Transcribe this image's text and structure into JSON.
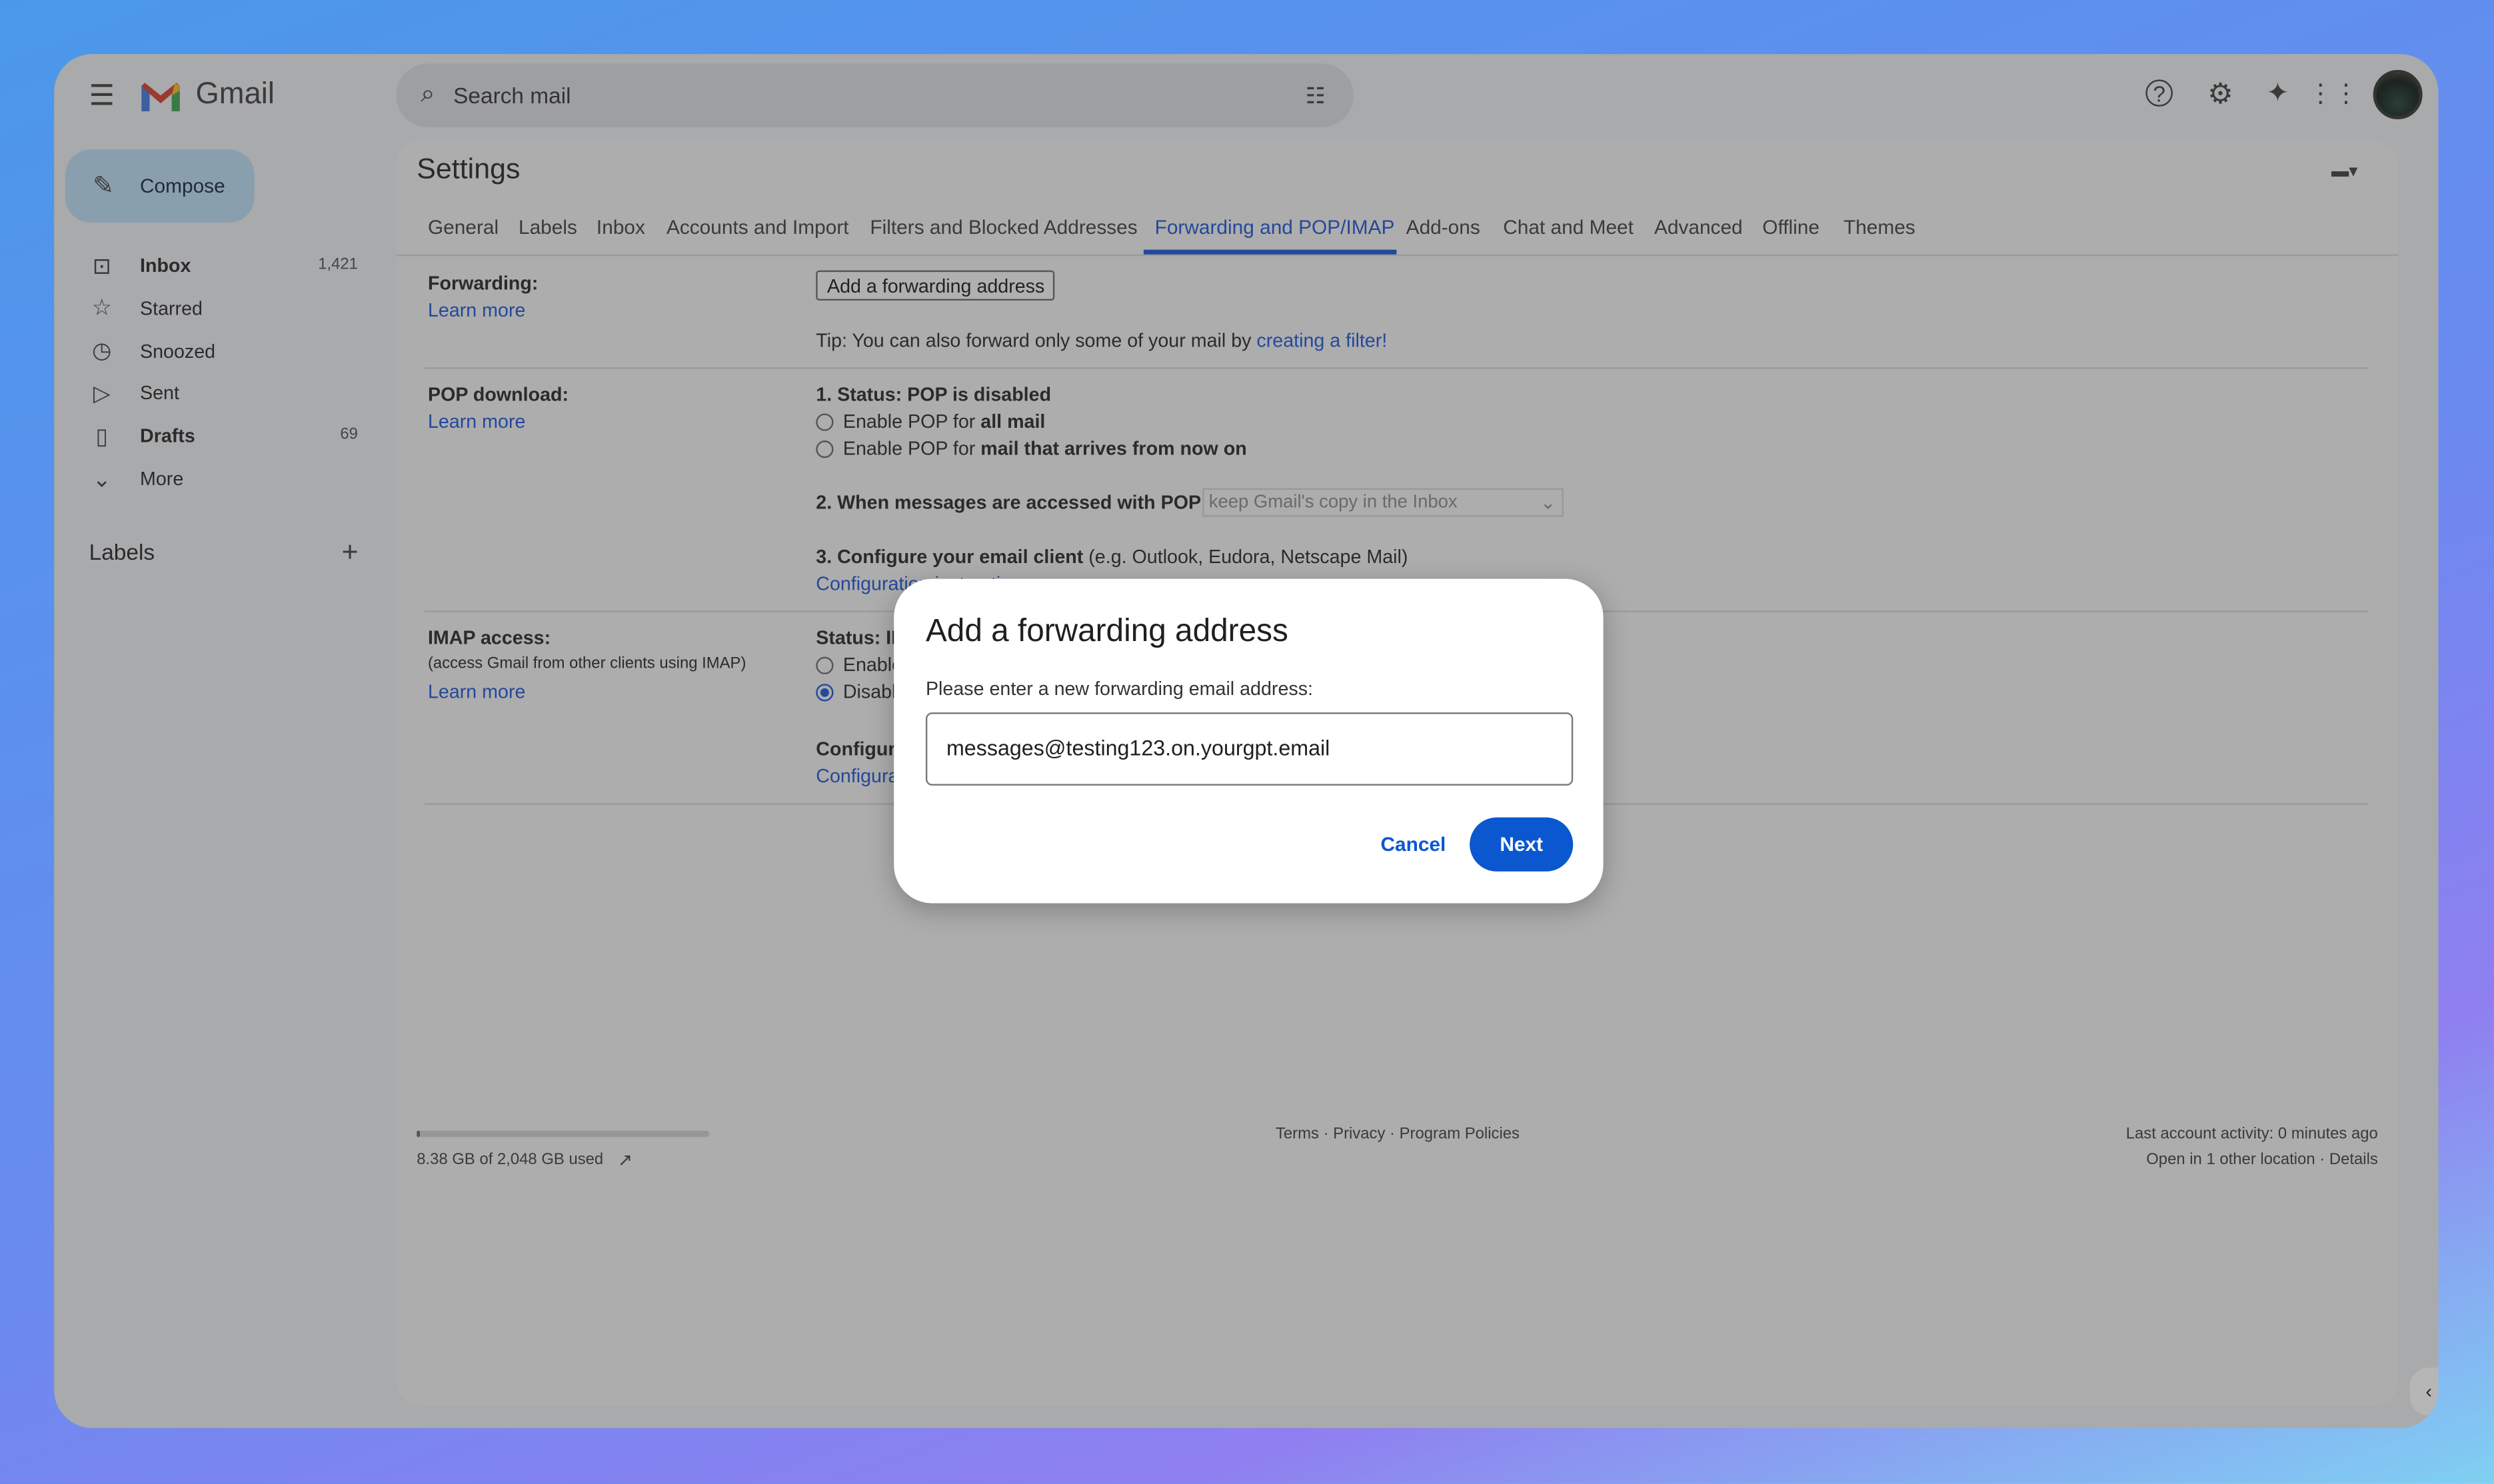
{
  "app": {
    "name": "Gmail"
  },
  "search": {
    "placeholder": "Search mail"
  },
  "compose": {
    "label": "Compose"
  },
  "nav": [
    {
      "label": "Inbox",
      "count": "1,421",
      "icon": "inbox-icon",
      "bold": true
    },
    {
      "label": "Starred",
      "count": "",
      "icon": "star-icon"
    },
    {
      "label": "Snoozed",
      "count": "",
      "icon": "clock-icon"
    },
    {
      "label": "Sent",
      "count": "",
      "icon": "send-icon"
    },
    {
      "label": "Drafts",
      "count": "69",
      "icon": "file-icon",
      "bold": true
    },
    {
      "label": "More",
      "count": "",
      "icon": "chevron-down-icon"
    }
  ],
  "labels": {
    "heading": "Labels"
  },
  "settings": {
    "title": "Settings",
    "tabs": [
      "General",
      "Labels",
      "Inbox",
      "Accounts and Import",
      "Filters and Blocked Addresses",
      "Forwarding and POP/IMAP",
      "Add-ons",
      "Chat and Meet",
      "Advanced",
      "Offline",
      "Themes"
    ],
    "active_tab": "Forwarding and POP/IMAP",
    "forwarding": {
      "label": "Forwarding:",
      "learn_more": "Learn more",
      "button": "Add a forwarding address",
      "tip": "Tip: You can also forward only some of your mail by ",
      "tip_link": "creating a filter!"
    },
    "pop": {
      "label": "POP download:",
      "learn_more": "Learn more",
      "status": "1. Status: POP is disabled",
      "opt1_pre": "Enable POP for ",
      "opt1_b": "all mail",
      "opt2_pre": "Enable POP for ",
      "opt2_b": "mail that arrives from now on",
      "when": "2. When messages are accessed with POP",
      "when_select": "keep Gmail's copy in the Inbox",
      "configure_b": "3. Configure your email client",
      "configure_rest": " (e.g. Outlook, Eudora, Netscape Mail)",
      "config_link": "Configuration instructions"
    },
    "imap": {
      "label": "IMAP access:",
      "sub": "(access Gmail from other clients using IMAP)",
      "learn_more": "Learn more",
      "status": "Status: IMAP is disabled",
      "opt1": "Enable IMAP",
      "opt2": "Disable IMAP",
      "configure": "Configure your email client",
      "config_link": "Configuration instructions"
    }
  },
  "footer": {
    "storage": "8.38 GB of 2,048 GB used",
    "storage_fraction": 0.004,
    "links": "Terms · Privacy · Program Policies",
    "activity": "Last account activity: 0 minutes ago",
    "location": "Open in 1 other location · Details"
  },
  "dialog": {
    "title": "Add a forwarding address",
    "prompt": "Please enter a new forwarding email address:",
    "value": "messages@testing123.on.yourgpt.email",
    "cancel": "Cancel",
    "next": "Next"
  },
  "colors": {
    "accent": "#0b57d0"
  }
}
